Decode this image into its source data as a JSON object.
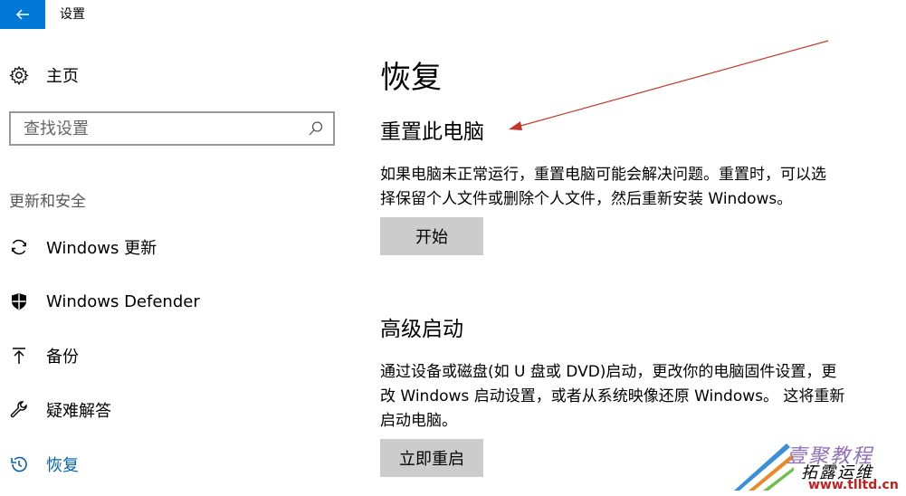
{
  "window": {
    "title": "设置",
    "accent": "#0078d7"
  },
  "sidebar": {
    "home_label": "主页",
    "search_placeholder": "查找设置",
    "section_label": "更新和安全",
    "items": [
      {
        "label": "Windows 更新",
        "icon": "sync-icon"
      },
      {
        "label": "Windows Defender",
        "icon": "shield-icon"
      },
      {
        "label": "备份",
        "icon": "upload-arrow-icon"
      },
      {
        "label": "疑难解答",
        "icon": "wrench-icon"
      },
      {
        "label": "恢复",
        "icon": "history-icon",
        "active": true
      }
    ]
  },
  "main": {
    "title": "恢复",
    "reset": {
      "heading": "重置此电脑",
      "line1": "如果电脑未正常运行，重置电脑可能会解决问题。重置时，可以选",
      "line2": "择保留个人文件或删除个人文件，然后重新安装 Windows。",
      "button_label": "开始"
    },
    "advanced": {
      "heading": "高级启动",
      "line1": "通过设备或磁盘(如 U 盘或 DVD)启动，更改你的电脑固件设置，更",
      "line2": "改 Windows 启动设置，或者从系统映像还原 Windows。 这将重新",
      "line3": "启动电脑。",
      "button_label": "立即重启"
    }
  },
  "annotation": {
    "arrow_color": "#c0392b"
  },
  "watermark": {
    "line1": "壹聚教程",
    "line2": "拓露运维",
    "url": "www.tlltd.cn"
  }
}
